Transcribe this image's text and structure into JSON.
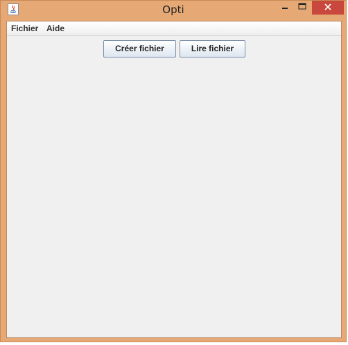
{
  "window": {
    "title": "Opti",
    "icon": "java-app-icon",
    "controls": {
      "minimize_icon": "minimize-icon",
      "maximize_icon": "maximize-icon",
      "close_icon": "close-icon"
    },
    "colors": {
      "frame": "#e6a975",
      "close_button": "#c9483d",
      "client_background": "#f0f0f0"
    }
  },
  "menubar": {
    "items": [
      {
        "label": "Fichier"
      },
      {
        "label": "Aide"
      }
    ]
  },
  "toolbar": {
    "create_file_label": "Créer fichier",
    "read_file_label": "Lire fichier"
  }
}
